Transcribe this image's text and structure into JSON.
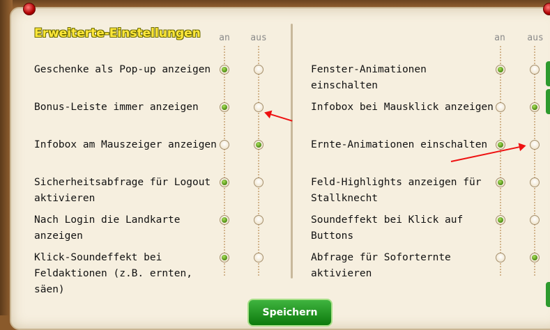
{
  "section": {
    "title": "Erweiterte-Einstellungen"
  },
  "columns": {
    "on": "an",
    "off": "aus"
  },
  "left_settings": [
    {
      "label": "Geschenke als Pop-up anzeigen",
      "value": "an"
    },
    {
      "label": "Bonus-Leiste immer anzeigen",
      "value": "an"
    },
    {
      "label": "Infobox am Mauszeiger anzeigen",
      "value": "aus"
    },
    {
      "label": "Sicherheitsabfrage für Logout aktivieren",
      "value": "an"
    },
    {
      "label": "Nach Login die Landkarte anzeigen",
      "value": "an"
    },
    {
      "label": "Klick-Soundeffekt bei Feldaktionen (z.B. ernten, säen)",
      "value": "an"
    }
  ],
  "right_settings": [
    {
      "label": "Fenster-Animationen einschalten",
      "value": "an"
    },
    {
      "label": "Infobox bei Mausklick anzeigen",
      "value": "aus"
    },
    {
      "label": "Ernte-Animationen einschalten",
      "value": "an"
    },
    {
      "label": "Feld-Highlights anzeigen für Stallknecht",
      "value": "an"
    },
    {
      "label": "Soundeffekt bei Klick auf Buttons",
      "value": "an"
    },
    {
      "label": "Abfrage für Soforternte aktivieren",
      "value": "aus"
    }
  ],
  "save_button": {
    "label": "Speichern"
  },
  "colors": {
    "title": "#ffe83a",
    "panel": "#f6efdf",
    "radio_on": "#4b8a12",
    "arrow": "#e11111",
    "button": "#1a8a1a"
  }
}
